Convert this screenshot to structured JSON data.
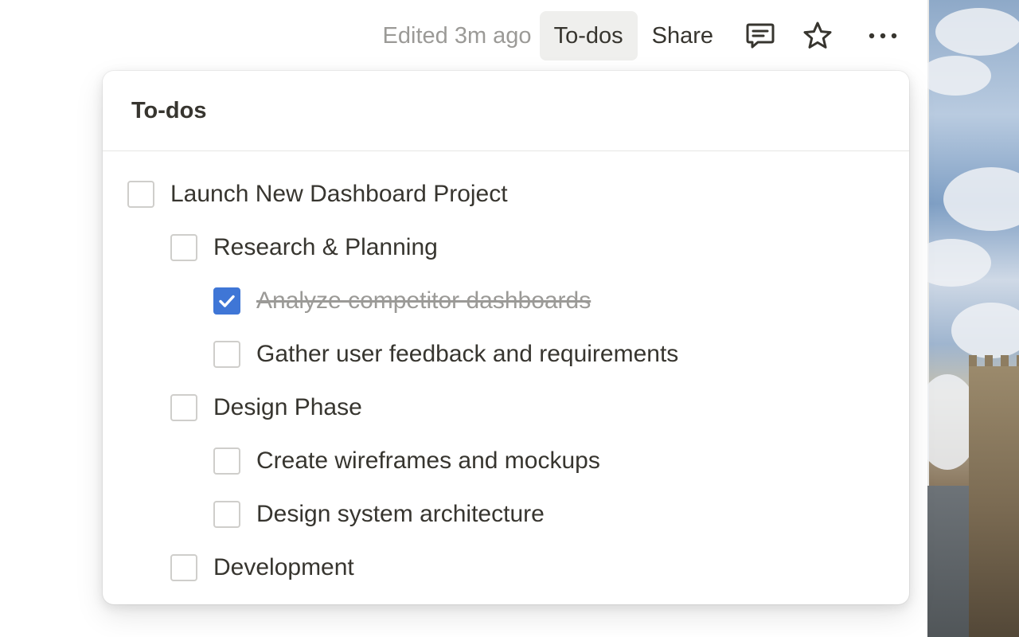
{
  "topbar": {
    "edited_text": "Edited 3m ago",
    "todos_label": "To-dos",
    "share_label": "Share",
    "comment_icon": "comment-icon",
    "star_icon": "star-icon",
    "more_icon": "more-icon"
  },
  "panel": {
    "title": "To-dos",
    "items": [
      {
        "label": "Launch New Dashboard Project",
        "level": 0,
        "checked": false
      },
      {
        "label": "Research & Planning",
        "level": 1,
        "checked": false
      },
      {
        "label": "Analyze competitor dashboards",
        "level": 2,
        "checked": true
      },
      {
        "label": "Gather user feedback and requirements",
        "level": 2,
        "checked": false
      },
      {
        "label": "Design Phase",
        "level": 1,
        "checked": false
      },
      {
        "label": "Create wireframes and mockups",
        "level": 2,
        "checked": false
      },
      {
        "label": "Design system architecture",
        "level": 2,
        "checked": false
      },
      {
        "label": "Development",
        "level": 1,
        "checked": false
      }
    ]
  },
  "colors": {
    "checkbox_checked": "#3f76d6",
    "text_primary": "#37352f",
    "text_muted": "#9b9a97"
  }
}
